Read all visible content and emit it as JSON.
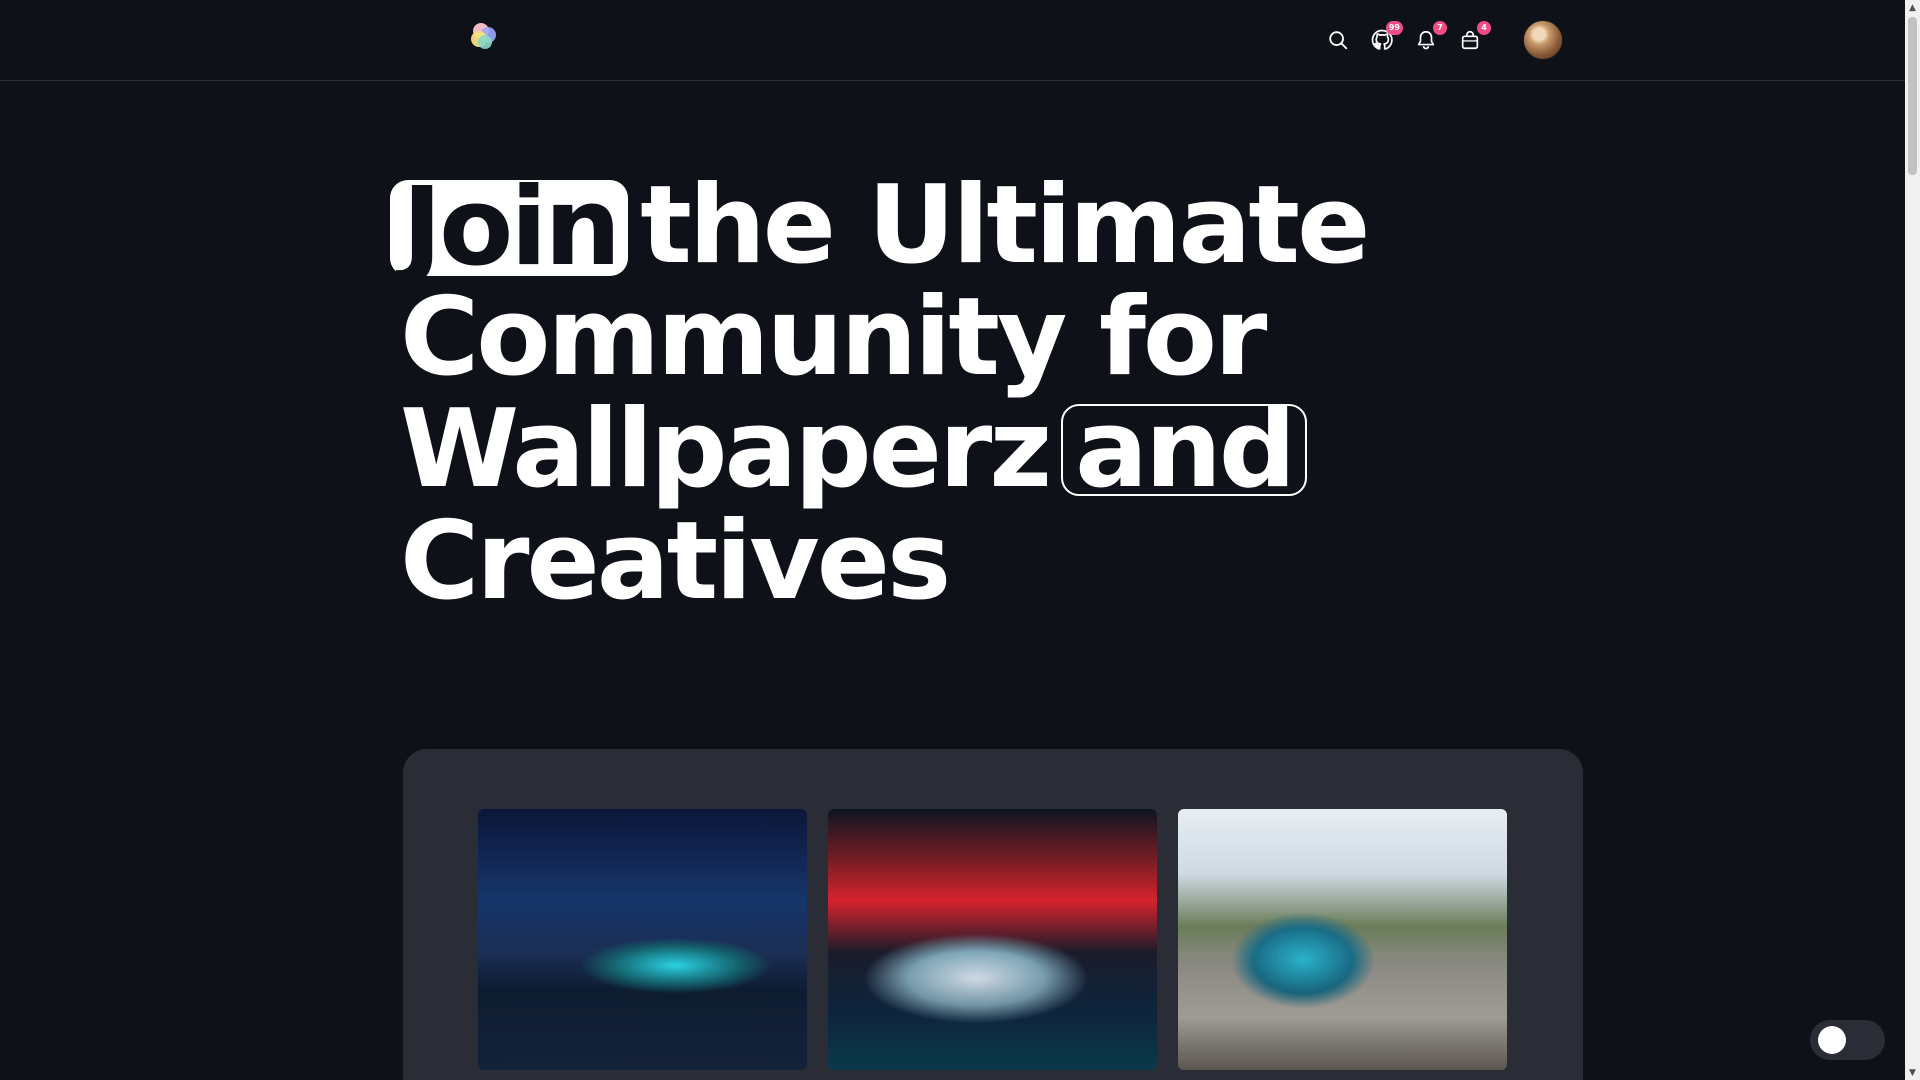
{
  "header": {
    "badges": {
      "github": "99",
      "notifications": "7",
      "cart": "4"
    }
  },
  "hero": {
    "word_join": "Join",
    "line1_rest": "the Ultimate",
    "line2": "Community for",
    "line3_main": "Wallpaperz",
    "word_and": "and",
    "line4": "Creatives"
  },
  "gallery": {
    "images": [
      {
        "subject": "dark car on wet road at night"
      },
      {
        "subject": "light blue car in front of red neon background"
      },
      {
        "subject": "blue car drifting under power lines"
      }
    ]
  },
  "theme": {
    "mode": "dark"
  },
  "colors": {
    "background": "#0f1118",
    "panel": "#2a2d36",
    "badge": "#f14b84",
    "text": "#ffffff"
  }
}
